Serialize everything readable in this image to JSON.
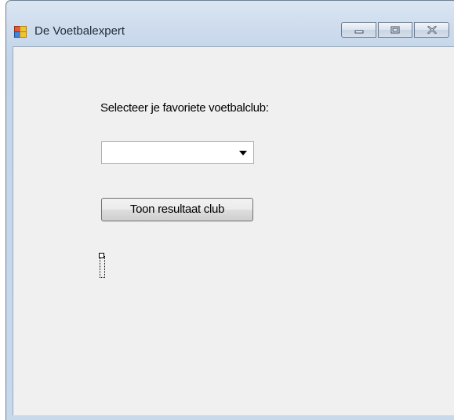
{
  "window": {
    "title": "De Voetbalexpert",
    "controls": {
      "minimize_icon": "minimize-icon",
      "maximize_icon": "maximize-icon",
      "close_icon": "close-icon"
    }
  },
  "form": {
    "prompt_label": "Selecteer je favoriete voetbalclub:",
    "club_select": {
      "selected_value": "",
      "arrow_icon": "chevron-down-icon"
    },
    "show_button_label": "Toon resultaat club",
    "result_label_text": ""
  },
  "colors": {
    "form_background": "#f0f0f0",
    "titlebar_gradient_top": "#dbe6f3",
    "titlebar_gradient_bottom": "#c4d5ea"
  }
}
